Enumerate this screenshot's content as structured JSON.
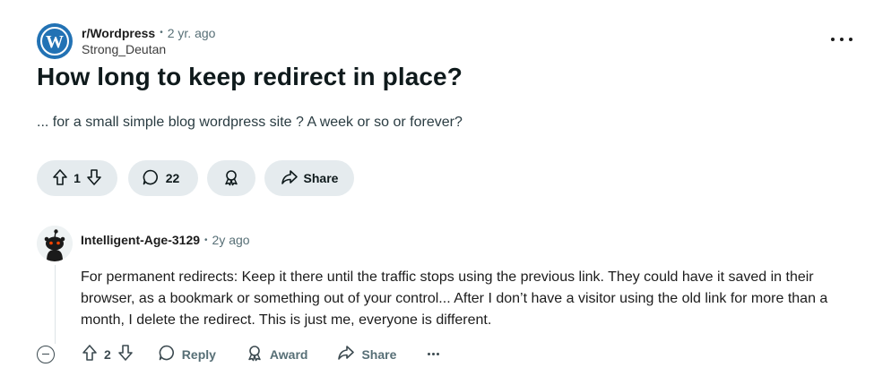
{
  "post": {
    "subreddit": "r/Wordpress",
    "time": "2 yr. ago",
    "author": "Strong_Deutan",
    "title": "How long to keep redirect in place?",
    "body": "... for a small simple blog wordpress site ? A week or so or forever?",
    "vote_count": "1",
    "comment_count": "22",
    "share_label": "Share",
    "separator": "•"
  },
  "comment": {
    "username": "Intelligent-Age-3129",
    "time": "2y ago",
    "separator": "•",
    "body": "For permanent redirects: Keep it there until the traffic stops using the previous link. They could have it saved in their browser, as a bookmark or something out of your control... After I don’t have a visitor using the old link for more than a month, I delete the redirect. This is just me, everyone is different.",
    "vote_count": "2",
    "reply_label": "Reply",
    "award_label": "Award",
    "share_label": "Share"
  },
  "icons": {
    "subreddit_avatar": "wordpress-logo-icon",
    "upvote": "arrow-up-icon",
    "downvote": "arrow-down-icon",
    "comment": "speech-bubble-icon",
    "award": "award-icon",
    "share": "share-arrow-icon",
    "more": "ellipsis-icon",
    "collapse": "collapse-minus-icon",
    "user_avatar": "reddit-snoo-icon"
  },
  "colors": {
    "pill_bg": "#e5ebee",
    "wordpress_blue": "#2272b4",
    "meta_gray": "#576f76"
  }
}
